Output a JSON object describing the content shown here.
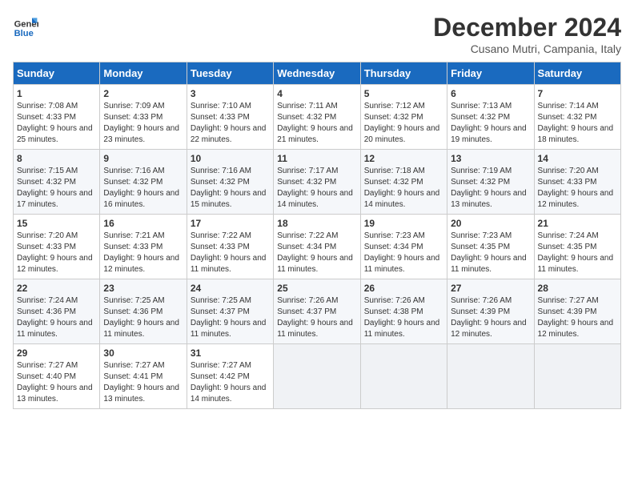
{
  "logo": {
    "line1": "General",
    "line2": "Blue"
  },
  "title": "December 2024",
  "subtitle": "Cusano Mutri, Campania, Italy",
  "headers": [
    "Sunday",
    "Monday",
    "Tuesday",
    "Wednesday",
    "Thursday",
    "Friday",
    "Saturday"
  ],
  "weeks": [
    [
      {
        "day": "1",
        "sunrise": "7:08 AM",
        "sunset": "4:33 PM",
        "daylight": "9 hours and 25 minutes."
      },
      {
        "day": "2",
        "sunrise": "7:09 AM",
        "sunset": "4:33 PM",
        "daylight": "9 hours and 23 minutes."
      },
      {
        "day": "3",
        "sunrise": "7:10 AM",
        "sunset": "4:33 PM",
        "daylight": "9 hours and 22 minutes."
      },
      {
        "day": "4",
        "sunrise": "7:11 AM",
        "sunset": "4:32 PM",
        "daylight": "9 hours and 21 minutes."
      },
      {
        "day": "5",
        "sunrise": "7:12 AM",
        "sunset": "4:32 PM",
        "daylight": "9 hours and 20 minutes."
      },
      {
        "day": "6",
        "sunrise": "7:13 AM",
        "sunset": "4:32 PM",
        "daylight": "9 hours and 19 minutes."
      },
      {
        "day": "7",
        "sunrise": "7:14 AM",
        "sunset": "4:32 PM",
        "daylight": "9 hours and 18 minutes."
      }
    ],
    [
      {
        "day": "8",
        "sunrise": "7:15 AM",
        "sunset": "4:32 PM",
        "daylight": "9 hours and 17 minutes."
      },
      {
        "day": "9",
        "sunrise": "7:16 AM",
        "sunset": "4:32 PM",
        "daylight": "9 hours and 16 minutes."
      },
      {
        "day": "10",
        "sunrise": "7:16 AM",
        "sunset": "4:32 PM",
        "daylight": "9 hours and 15 minutes."
      },
      {
        "day": "11",
        "sunrise": "7:17 AM",
        "sunset": "4:32 PM",
        "daylight": "9 hours and 14 minutes."
      },
      {
        "day": "12",
        "sunrise": "7:18 AM",
        "sunset": "4:32 PM",
        "daylight": "9 hours and 14 minutes."
      },
      {
        "day": "13",
        "sunrise": "7:19 AM",
        "sunset": "4:32 PM",
        "daylight": "9 hours and 13 minutes."
      },
      {
        "day": "14",
        "sunrise": "7:20 AM",
        "sunset": "4:33 PM",
        "daylight": "9 hours and 12 minutes."
      }
    ],
    [
      {
        "day": "15",
        "sunrise": "7:20 AM",
        "sunset": "4:33 PM",
        "daylight": "9 hours and 12 minutes."
      },
      {
        "day": "16",
        "sunrise": "7:21 AM",
        "sunset": "4:33 PM",
        "daylight": "9 hours and 12 minutes."
      },
      {
        "day": "17",
        "sunrise": "7:22 AM",
        "sunset": "4:33 PM",
        "daylight": "9 hours and 11 minutes."
      },
      {
        "day": "18",
        "sunrise": "7:22 AM",
        "sunset": "4:34 PM",
        "daylight": "9 hours and 11 minutes."
      },
      {
        "day": "19",
        "sunrise": "7:23 AM",
        "sunset": "4:34 PM",
        "daylight": "9 hours and 11 minutes."
      },
      {
        "day": "20",
        "sunrise": "7:23 AM",
        "sunset": "4:35 PM",
        "daylight": "9 hours and 11 minutes."
      },
      {
        "day": "21",
        "sunrise": "7:24 AM",
        "sunset": "4:35 PM",
        "daylight": "9 hours and 11 minutes."
      }
    ],
    [
      {
        "day": "22",
        "sunrise": "7:24 AM",
        "sunset": "4:36 PM",
        "daylight": "9 hours and 11 minutes."
      },
      {
        "day": "23",
        "sunrise": "7:25 AM",
        "sunset": "4:36 PM",
        "daylight": "9 hours and 11 minutes."
      },
      {
        "day": "24",
        "sunrise": "7:25 AM",
        "sunset": "4:37 PM",
        "daylight": "9 hours and 11 minutes."
      },
      {
        "day": "25",
        "sunrise": "7:26 AM",
        "sunset": "4:37 PM",
        "daylight": "9 hours and 11 minutes."
      },
      {
        "day": "26",
        "sunrise": "7:26 AM",
        "sunset": "4:38 PM",
        "daylight": "9 hours and 11 minutes."
      },
      {
        "day": "27",
        "sunrise": "7:26 AM",
        "sunset": "4:39 PM",
        "daylight": "9 hours and 12 minutes."
      },
      {
        "day": "28",
        "sunrise": "7:27 AM",
        "sunset": "4:39 PM",
        "daylight": "9 hours and 12 minutes."
      }
    ],
    [
      {
        "day": "29",
        "sunrise": "7:27 AM",
        "sunset": "4:40 PM",
        "daylight": "9 hours and 13 minutes."
      },
      {
        "day": "30",
        "sunrise": "7:27 AM",
        "sunset": "4:41 PM",
        "daylight": "9 hours and 13 minutes."
      },
      {
        "day": "31",
        "sunrise": "7:27 AM",
        "sunset": "4:42 PM",
        "daylight": "9 hours and 14 minutes."
      },
      null,
      null,
      null,
      null
    ]
  ],
  "labels": {
    "sunrise": "Sunrise:",
    "sunset": "Sunset:",
    "daylight": "Daylight:"
  }
}
